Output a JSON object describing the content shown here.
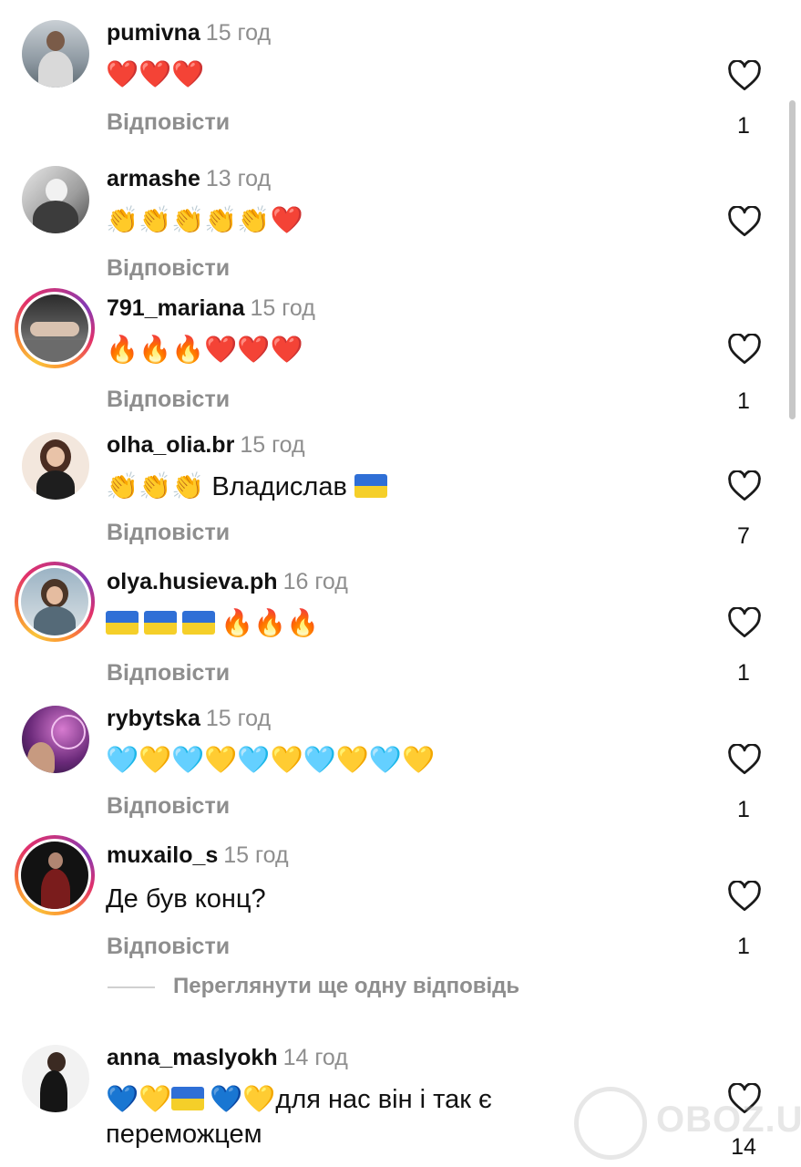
{
  "comments": [
    {
      "username": "pumivna",
      "time": "15 год",
      "text": "❤️❤️❤️",
      "reply": "Відповісти",
      "likes": "1"
    },
    {
      "username": "armashe",
      "time": "13 год",
      "text": "👏👏👏👏👏❤️",
      "reply": "Відповісти",
      "likes": ""
    },
    {
      "username": "791_mariana",
      "time": "15 год",
      "text": "🔥🔥🔥❤️❤️❤️",
      "reply": "Відповісти",
      "likes": "1"
    },
    {
      "username": "olha_olia.br",
      "time": "15 год",
      "text_prefix": "👏👏👏 ",
      "text": "Владислав",
      "reply": "Відповісти",
      "likes": "7"
    },
    {
      "username": "olya.husieva.ph",
      "time": "16 год",
      "text": "🔥🔥🔥",
      "reply": "Відповісти",
      "likes": "1"
    },
    {
      "username": "rybytska",
      "time": "15 год",
      "text": "🩵💛🩵💛🩵💛🩵💛🩵💛",
      "reply": "Відповісти",
      "likes": "1"
    },
    {
      "username": "muxailo_s",
      "time": "15 год",
      "text": "Де був конц?",
      "reply": "Відповісти",
      "likes": "1"
    },
    {
      "username": "anna_maslyokh",
      "time": "14 год",
      "text_a": "💙💛",
      "text_b": "💙💛для нас він і так є",
      "text_line2": "переможцем",
      "likes": "14"
    }
  ],
  "view_more_replies": "Переглянути ще одну відповідь",
  "watermark": "OBOZ.UA",
  "icons": {
    "like": "heart-outline-icon",
    "flag": "ukraine-flag-icon"
  },
  "colors": {
    "muted": "#8e8e8e",
    "text": "#111111",
    "flag_blue": "#2f6fd6",
    "flag_yellow": "#f5cf29"
  }
}
